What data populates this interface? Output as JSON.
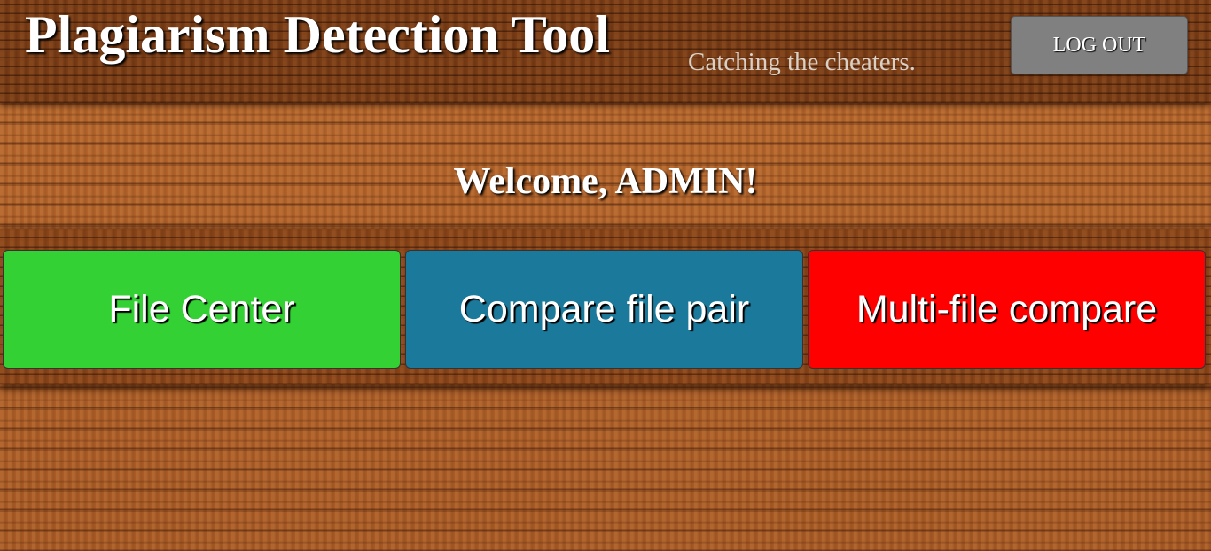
{
  "header": {
    "title": "Plagiarism Detection Tool",
    "tagline": "Catching the cheaters.",
    "logout_label": "LOG OUT"
  },
  "welcome": {
    "text": "Welcome, ADMIN!"
  },
  "nav": {
    "buttons": [
      {
        "label": "File Center",
        "color": "#33d133"
      },
      {
        "label": "Compare file pair",
        "color": "#1b7a9c"
      },
      {
        "label": "Multi-file compare",
        "color": "#ff0000"
      }
    ]
  },
  "colors": {
    "logout_button": "#808080",
    "wood": "#b0622a",
    "wood_dark": "#7a3c15"
  }
}
